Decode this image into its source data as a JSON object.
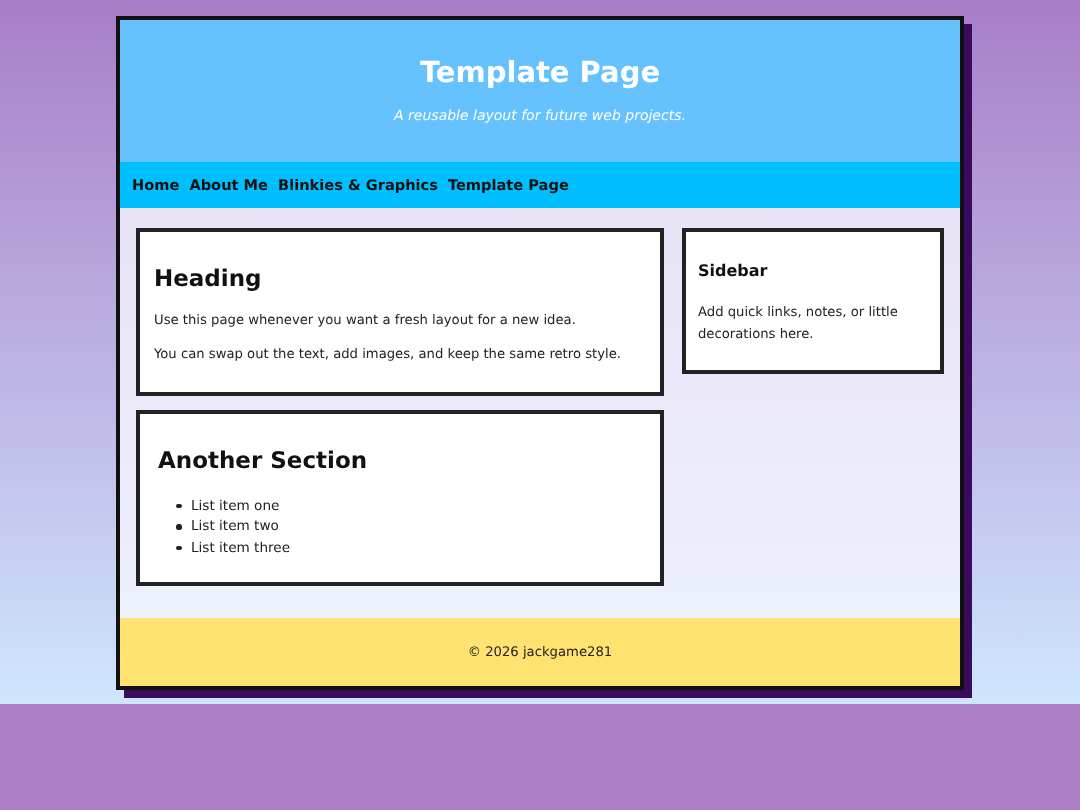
{
  "header": {
    "title": "Template Page",
    "tagline": "A reusable layout for future web projects."
  },
  "nav": [
    {
      "label": "Home"
    },
    {
      "label": "About Me"
    },
    {
      "label": "Blinkies & Graphics"
    },
    {
      "label": "Template Page"
    }
  ],
  "sections": [
    {
      "heading": "Heading",
      "kind": "paragraphs",
      "paragraphs": [
        "Use this page whenever you want a fresh layout for a new idea.",
        "You can swap out the text, add images, and keep the same retro style."
      ]
    },
    {
      "heading": "Another Section",
      "kind": "list",
      "items": [
        "List item one",
        "List item two",
        "List item three"
      ]
    }
  ],
  "sidebar": {
    "heading": "Sidebar",
    "text": "Add quick links, notes, or little decorations here."
  },
  "footer": "© 2026 jackgame281"
}
